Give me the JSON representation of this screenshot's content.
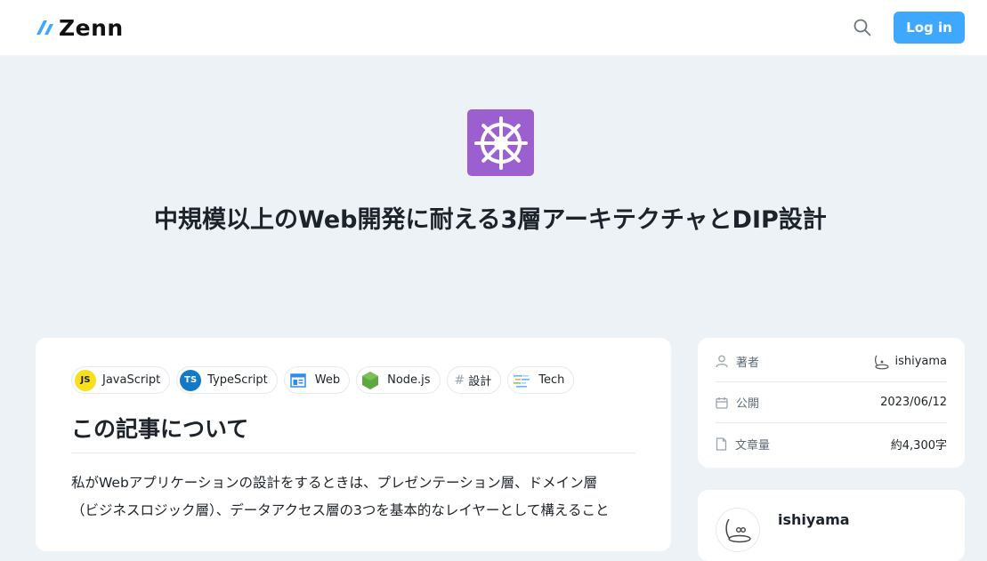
{
  "header": {
    "logo_text": "Zenn",
    "login_label": "Log in",
    "accent_color": "#3ea8ff"
  },
  "article": {
    "emoji_icon": "dharma-wheel-icon",
    "emoji_bg_color": "#9b5fcf",
    "title": "中規模以上のWeb開発に耐える3層アーキテクチャとDIP設計",
    "topics": [
      {
        "label": "JavaScript",
        "icon": "javascript-icon"
      },
      {
        "label": "TypeScript",
        "icon": "typescript-icon"
      },
      {
        "label": "Web",
        "icon": "web-icon"
      },
      {
        "label": "Node.js",
        "icon": "nodejs-icon"
      },
      {
        "label": "設計",
        "icon": "hash-icon"
      },
      {
        "label": "Tech",
        "icon": "tech-icon"
      }
    ],
    "section_heading": "この記事について",
    "body_lines": [
      "私がWebアプリケーションの設計をするときは、プレゼンテーション層、ドメイン層",
      "（ビジネスロジック層）、データアクセス層の3つを基本的なレイヤーとして構えること"
    ]
  },
  "sidebar": {
    "info": [
      {
        "label": "著者",
        "value": "ishiyama",
        "icon": "person-icon"
      },
      {
        "label": "公開",
        "value": "2023/06/12",
        "icon": "calendar-icon"
      },
      {
        "label": "文章量",
        "value": "約4,300字",
        "icon": "document-icon"
      }
    ],
    "author_name": "ishiyama"
  }
}
